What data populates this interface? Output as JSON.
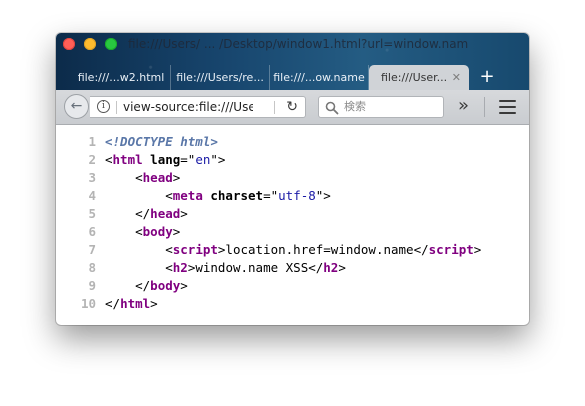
{
  "window": {
    "title": "file:///Users/ ... /Desktop/window1.html?url=window.nam",
    "tabs": [
      {
        "label": "file:///...w2.html",
        "active": false
      },
      {
        "label": "file:///Users/re...",
        "active": false
      },
      {
        "label": "file:///...ow.name",
        "active": false
      },
      {
        "label": "file:///User...",
        "active": true
      }
    ],
    "new_tab_label": "+"
  },
  "toolbar": {
    "back_label": "←",
    "info_label": "i",
    "url_value": "view-source:file:///Use",
    "reload_label": "↻",
    "search_placeholder": "検索",
    "overflow_label": "»"
  },
  "source": {
    "lines": [
      {
        "n": "1",
        "indent": "",
        "tokens": [
          {
            "t": "<!DOCTYPE html>",
            "c": "doctype"
          }
        ]
      },
      {
        "n": "2",
        "indent": "",
        "tokens": [
          {
            "t": "<",
            "c": "txt"
          },
          {
            "t": "html",
            "c": "tag"
          },
          {
            "t": " lang",
            "c": "attr"
          },
          {
            "t": "=\"",
            "c": "txt"
          },
          {
            "t": "en",
            "c": "val"
          },
          {
            "t": "\">",
            "c": "txt"
          }
        ]
      },
      {
        "n": "3",
        "indent": "    ",
        "tokens": [
          {
            "t": "<",
            "c": "txt"
          },
          {
            "t": "head",
            "c": "tag"
          },
          {
            "t": ">",
            "c": "txt"
          }
        ]
      },
      {
        "n": "4",
        "indent": "        ",
        "tokens": [
          {
            "t": "<",
            "c": "txt"
          },
          {
            "t": "meta",
            "c": "tag"
          },
          {
            "t": " charset",
            "c": "attr"
          },
          {
            "t": "=\"",
            "c": "txt"
          },
          {
            "t": "utf-8",
            "c": "val"
          },
          {
            "t": "\">",
            "c": "txt"
          }
        ]
      },
      {
        "n": "5",
        "indent": "    ",
        "tokens": [
          {
            "t": "</",
            "c": "txt"
          },
          {
            "t": "head",
            "c": "tag"
          },
          {
            "t": ">",
            "c": "txt"
          }
        ]
      },
      {
        "n": "6",
        "indent": "    ",
        "tokens": [
          {
            "t": "<",
            "c": "txt"
          },
          {
            "t": "body",
            "c": "tag"
          },
          {
            "t": ">",
            "c": "txt"
          }
        ]
      },
      {
        "n": "7",
        "indent": "        ",
        "tokens": [
          {
            "t": "<",
            "c": "txt"
          },
          {
            "t": "script",
            "c": "tag"
          },
          {
            "t": ">location.href=window.name</",
            "c": "txt"
          },
          {
            "t": "script",
            "c": "tag"
          },
          {
            "t": ">",
            "c": "txt"
          }
        ]
      },
      {
        "n": "8",
        "indent": "        ",
        "tokens": [
          {
            "t": "<",
            "c": "txt"
          },
          {
            "t": "h2",
            "c": "tag"
          },
          {
            "t": ">window.name XSS</",
            "c": "txt"
          },
          {
            "t": "h2",
            "c": "tag"
          },
          {
            "t": ">",
            "c": "txt"
          }
        ]
      },
      {
        "n": "9",
        "indent": "    ",
        "tokens": [
          {
            "t": "</",
            "c": "txt"
          },
          {
            "t": "body",
            "c": "tag"
          },
          {
            "t": ">",
            "c": "txt"
          }
        ]
      },
      {
        "n": "10",
        "indent": "",
        "tokens": [
          {
            "t": "</",
            "c": "txt"
          },
          {
            "t": "html",
            "c": "tag"
          },
          {
            "t": ">",
            "c": "txt"
          }
        ]
      }
    ]
  },
  "colors": {
    "tag": "#800080",
    "attribute_value": "#1a1aa6",
    "doctype": "#5a77a8",
    "line_number": "#b4b4b4"
  }
}
